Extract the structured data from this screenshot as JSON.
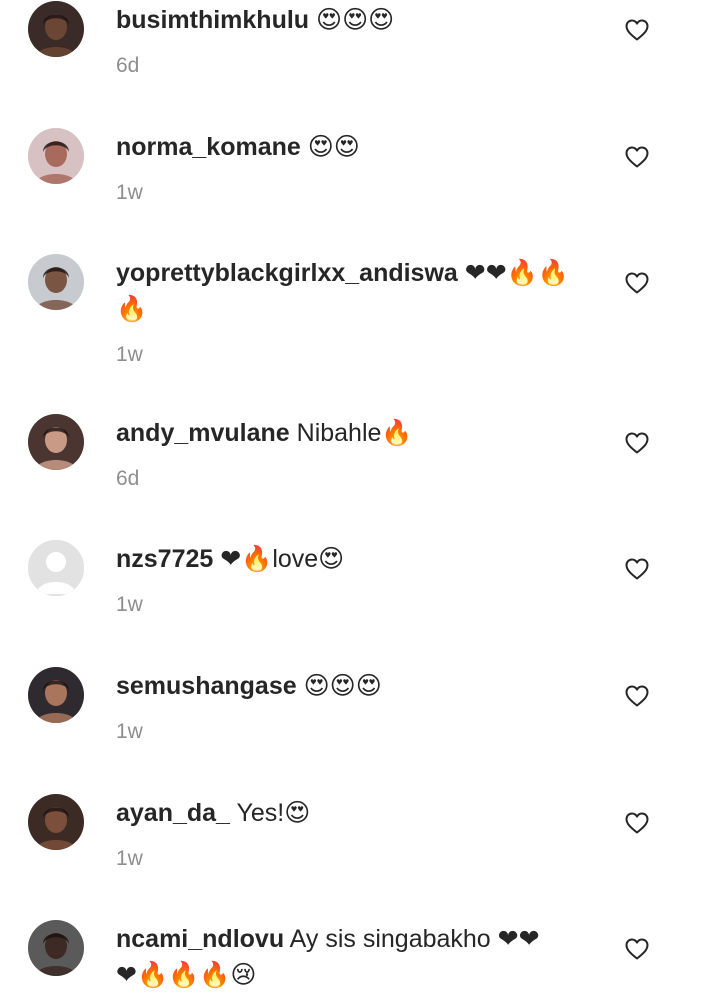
{
  "comments": [
    {
      "username": "busimthimkhulu",
      "message": " 😍😍😍",
      "message2": "",
      "time": "6d",
      "avatar_color": "#3a2a28",
      "avatar_skin": "#6b4634",
      "heart_icon": "heart-outline-icon"
    },
    {
      "username": "norma_komane",
      "message": " 😍😍",
      "message2": "",
      "time": "1w",
      "avatar_color": "#d7c1c3",
      "avatar_skin": "#a86a5c",
      "heart_icon": "heart-outline-icon"
    },
    {
      "username": "yoprettyblackgirlxx_andiswa",
      "message": " ❤❤🔥🔥",
      "message2": "🔥",
      "time": "1w",
      "avatar_color": "#c7cbd0",
      "avatar_skin": "#7a5544",
      "heart_icon": "heart-outline-icon"
    },
    {
      "username": "andy_mvulane",
      "message": " Nibahle🔥",
      "message2": "",
      "time": "6d",
      "avatar_color": "#4a3530",
      "avatar_skin": "#c99a86",
      "heart_icon": "heart-outline-icon"
    },
    {
      "username": "nzs7725",
      "message": " ❤🔥love😍",
      "message2": "",
      "time": "1w",
      "avatar_color": "#e2e2e2",
      "avatar_skin": "#ffffff",
      "heart_icon": "heart-outline-icon"
    },
    {
      "username": "semushangase",
      "message": " 😍😍😍",
      "message2": "",
      "time": "1w",
      "avatar_color": "#2f2a2f",
      "avatar_skin": "#a9755c",
      "heart_icon": "heart-outline-icon"
    },
    {
      "username": "ayan_da_",
      "message": " Yes!😍",
      "message2": "",
      "time": "1w",
      "avatar_color": "#3c2b25",
      "avatar_skin": "#7b4f3b",
      "heart_icon": "heart-outline-icon"
    },
    {
      "username": "ncami_ndlovu",
      "message": " Ay sis singabakho ❤❤",
      "message2": "❤🔥🔥🔥😢",
      "time": "",
      "avatar_color": "#5a5a5a",
      "avatar_skin": "#3d2a24",
      "heart_icon": "heart-outline-icon"
    }
  ]
}
